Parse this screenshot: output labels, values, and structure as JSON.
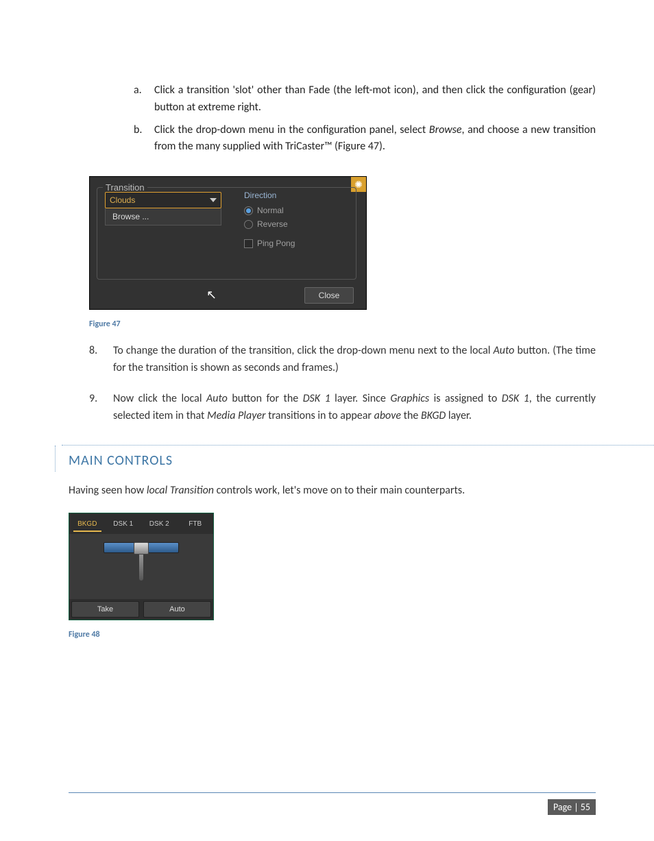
{
  "list_ab": {
    "a_marker": "a.",
    "a_text": "Click a transition 'slot' other than Fade (the left-mot icon), and then click the configuration (gear) button at extreme right.",
    "b_marker": "b.",
    "b_pre": "Click the drop-down menu in the configuration panel, select ",
    "b_em": "Browse",
    "b_post": ", and choose a new transition from the many supplied with TriCaster™ (Figure 47)."
  },
  "fig47": {
    "legend": "Transition",
    "clouds": "Clouds",
    "browse": "Browse ...",
    "direction": "Direction",
    "normal": "Normal",
    "reverse": "Reverse",
    "pingpong": "Ping Pong",
    "close": "Close",
    "caption": "Figure 47"
  },
  "list_89": {
    "n8_marker": "8.",
    "n8_pre": "To change the duration of the transition, click the drop-down menu next to the local ",
    "n8_em": "Auto",
    "n8_post": " button.  (The time for the transition is shown as seconds and frames.)",
    "n9_marker": "9.",
    "n9_a": "Now click the local ",
    "n9_b": "Auto",
    "n9_c": " button for the ",
    "n9_d": "DSK 1",
    "n9_e": " layer.  Since ",
    "n9_f": "Graphics",
    "n9_g": " is assigned to ",
    "n9_h": "DSK 1",
    "n9_i": ", the currently selected item in that ",
    "n9_j": "Media Player",
    "n9_k": " transitions in to appear ",
    "n9_l": "above",
    "n9_m": " the ",
    "n9_n": "BKGD",
    "n9_o": " layer."
  },
  "section": {
    "title": "MAIN CONTROLS",
    "para_a": "Having seen how ",
    "para_b": "local Transition",
    "para_c": " controls work, let's move on to their main counterparts."
  },
  "fig48": {
    "tabs": {
      "bkgd": "BKGD",
      "dsk1": "DSK 1",
      "dsk2": "DSK 2",
      "ftb": "FTB"
    },
    "take": "Take",
    "auto": "Auto",
    "caption": "Figure 48"
  },
  "footer": {
    "page": "Page | 55"
  }
}
